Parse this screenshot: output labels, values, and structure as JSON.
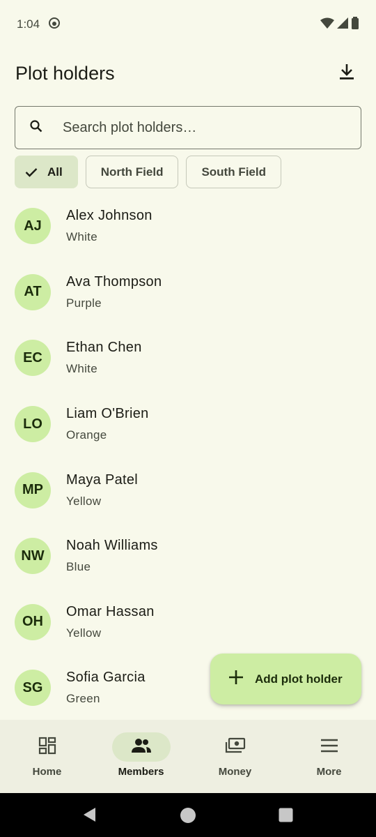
{
  "status_bar": {
    "time": "1:04"
  },
  "app_bar": {
    "title": "Plot holders"
  },
  "search": {
    "placeholder": "Search plot holders…",
    "value": ""
  },
  "filters": [
    {
      "label": "All",
      "selected": true
    },
    {
      "label": "North Field",
      "selected": false
    },
    {
      "label": "South Field",
      "selected": false
    }
  ],
  "members": [
    {
      "initials": "AJ",
      "name": "Alex Johnson",
      "subtitle": "White"
    },
    {
      "initials": "AT",
      "name": "Ava Thompson",
      "subtitle": "Purple"
    },
    {
      "initials": "EC",
      "name": "Ethan Chen",
      "subtitle": "White"
    },
    {
      "initials": "LO",
      "name": "Liam O'Brien",
      "subtitle": "Orange"
    },
    {
      "initials": "MP",
      "name": "Maya Patel",
      "subtitle": "Yellow"
    },
    {
      "initials": "NW",
      "name": "Noah Williams",
      "subtitle": "Blue"
    },
    {
      "initials": "OH",
      "name": "Omar Hassan",
      "subtitle": "Yellow"
    },
    {
      "initials": "SG",
      "name": "Sofia Garcia",
      "subtitle": "Green"
    }
  ],
  "fab": {
    "label": "Add plot holder",
    "icon": "plus-icon"
  },
  "bottom_nav": [
    {
      "label": "Home",
      "icon": "dashboard-icon",
      "active": false
    },
    {
      "label": "Members",
      "icon": "group-icon",
      "active": true
    },
    {
      "label": "Money",
      "icon": "payments-icon",
      "active": false
    },
    {
      "label": "More",
      "icon": "menu-icon",
      "active": false
    }
  ],
  "colors": {
    "background": "#f8f9eb",
    "avatar": "#cdeda3",
    "selected_chip": "#dce7c8",
    "nav_bar": "#eeefe1"
  }
}
